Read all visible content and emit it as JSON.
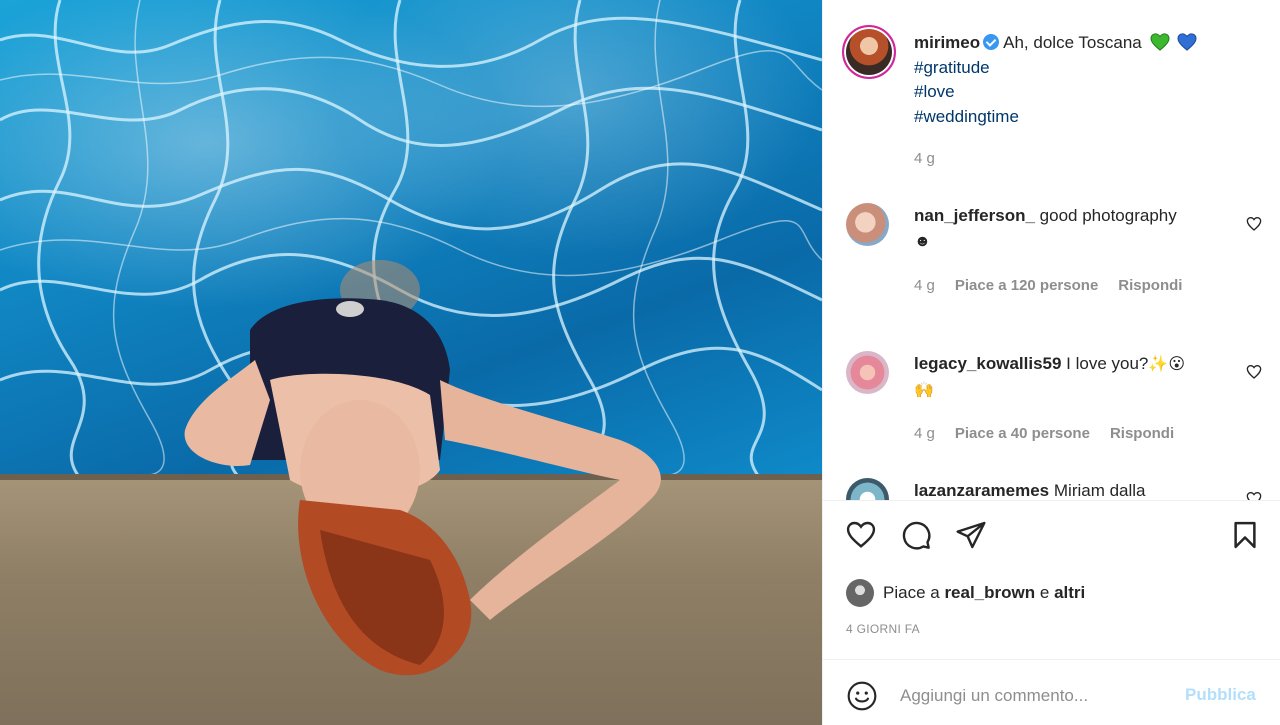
{
  "post": {
    "author": "mirimeo",
    "verified": true,
    "caption_text": "Ah, dolce Toscana",
    "caption_emojis": [
      "green-heart",
      "blue-heart"
    ],
    "hashtags": [
      "#gratitude",
      "#love",
      "#weddingtime"
    ],
    "time": "4 g"
  },
  "comments": [
    {
      "user": "nan_jefferson_",
      "text": "good photography",
      "emoji_line": "☻",
      "time": "4 g",
      "likes": "Piace a 120 persone",
      "reply": "Rispondi"
    },
    {
      "user": "legacy_kowallis59",
      "text": "I love you?",
      "emoji_inline": "✨😮",
      "emoji_line": "🙌",
      "time": "4 g",
      "likes": "Piace a 40 persone",
      "reply": "Rispondi"
    },
    {
      "user": "lazanzaramemes",
      "text": "Miriam dalla"
    }
  ],
  "liked_by": {
    "prefix": "Piace a",
    "user": "real_brown",
    "conj": "e",
    "others": "altri"
  },
  "date": "4 GIORNI FA",
  "comment_input": {
    "placeholder": "Aggiungi un commento...",
    "publish": "Pubblica"
  },
  "icons": {
    "like": "heart-icon",
    "comment": "comment-icon",
    "share": "share-icon",
    "save": "bookmark-icon",
    "emoji": "smiley-icon"
  },
  "colors": {
    "link": "#00376b",
    "muted": "#8e8e8e",
    "verified": "#3897f0",
    "publish_disabled": "#b2dffc"
  }
}
